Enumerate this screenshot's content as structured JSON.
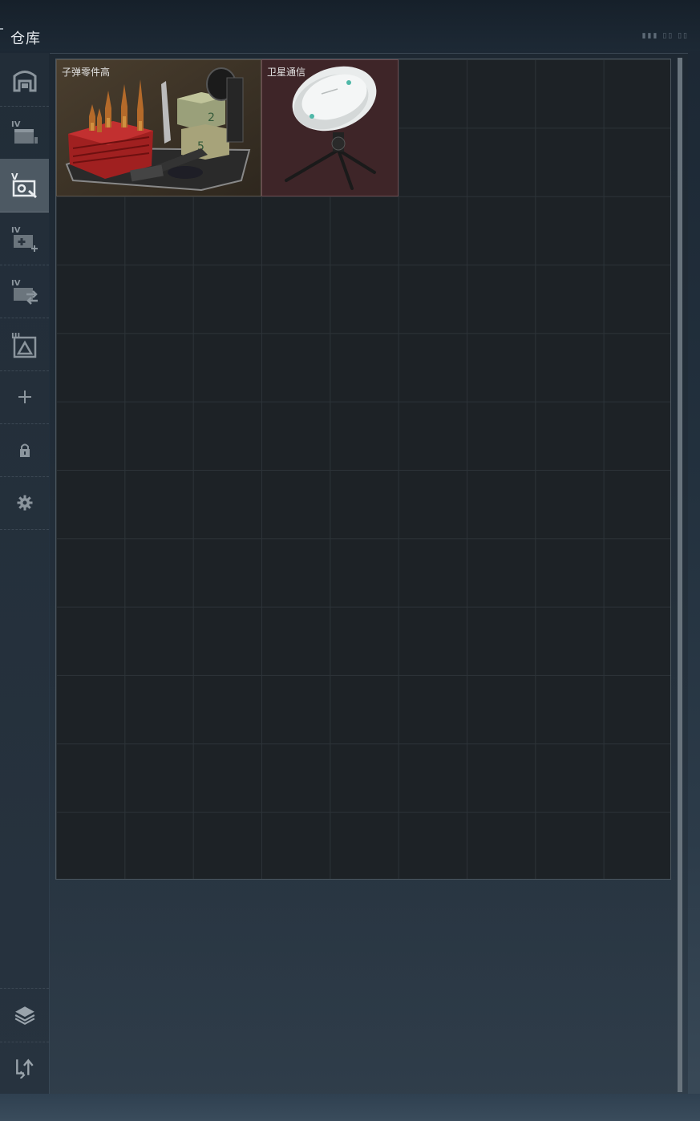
{
  "header": {
    "title": "仓库"
  },
  "sidebar": {
    "items": [
      {
        "icon": "storage-icon"
      },
      {
        "icon": "tier-iv-case-icon"
      },
      {
        "icon": "tier-v-search-case-icon"
      },
      {
        "icon": "tier-iv-add-case-icon"
      },
      {
        "icon": "tier-iv-transfer-case-icon"
      },
      {
        "icon": "tier-iii-container-icon"
      },
      {
        "icon": "plus-icon"
      },
      {
        "icon": "lock-icon"
      },
      {
        "icon": "gear-icon"
      },
      {
        "icon": "layers-icon"
      },
      {
        "icon": "sort-icon"
      }
    ]
  },
  "inventory": {
    "items": [
      {
        "name": "子弹零件高",
        "bg_color": "#3b3327",
        "icon": "ammo-parts-crate-icon"
      },
      {
        "name": "卫星通信",
        "bg_color": "#3e2528",
        "icon": "satellite-dish-icon"
      }
    ]
  }
}
